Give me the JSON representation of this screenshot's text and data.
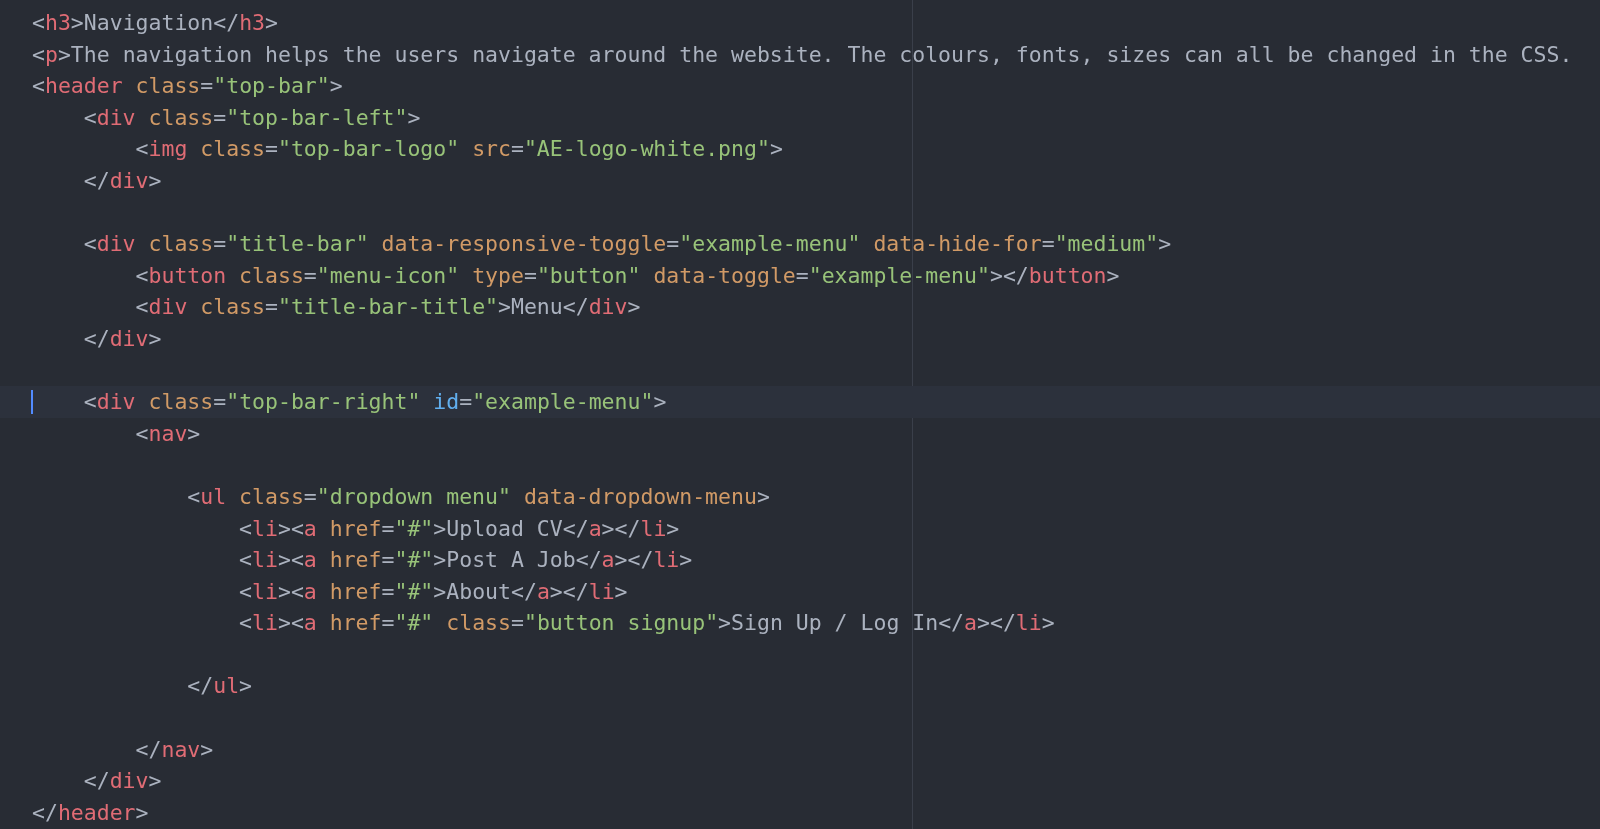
{
  "editor": {
    "lines": [
      {
        "active": false,
        "tokens": [
          {
            "kind": "punct",
            "text": "<"
          },
          {
            "kind": "tag",
            "text": "h3"
          },
          {
            "kind": "punct",
            "text": ">"
          },
          {
            "kind": "text",
            "text": "Navigation"
          },
          {
            "kind": "punct",
            "text": "</"
          },
          {
            "kind": "tag",
            "text": "h3"
          },
          {
            "kind": "punct",
            "text": ">"
          }
        ]
      },
      {
        "active": false,
        "tokens": [
          {
            "kind": "punct",
            "text": "<"
          },
          {
            "kind": "tag",
            "text": "p"
          },
          {
            "kind": "punct",
            "text": ">"
          },
          {
            "kind": "text",
            "text": "The navigation helps the users navigate around the website. The colours, fonts, sizes can all be changed in the CSS."
          }
        ]
      },
      {
        "active": false,
        "tokens": [
          {
            "kind": "punct",
            "text": "<"
          },
          {
            "kind": "tag",
            "text": "header"
          },
          {
            "kind": "attr",
            "text": " class"
          },
          {
            "kind": "punct",
            "text": "="
          },
          {
            "kind": "string",
            "text": "\"top-bar\""
          },
          {
            "kind": "punct",
            "text": ">"
          }
        ],
        "children": [
          {
            "active": false,
            "tokens": [
              {
                "kind": "punct",
                "text": "<"
              },
              {
                "kind": "tag",
                "text": "div"
              },
              {
                "kind": "attr",
                "text": " class"
              },
              {
                "kind": "punct",
                "text": "="
              },
              {
                "kind": "string",
                "text": "\"top-bar-left\""
              },
              {
                "kind": "punct",
                "text": ">"
              }
            ],
            "children": [
              {
                "active": false,
                "tokens": [
                  {
                    "kind": "punct",
                    "text": "<"
                  },
                  {
                    "kind": "tag",
                    "text": "img"
                  },
                  {
                    "kind": "attr",
                    "text": " class"
                  },
                  {
                    "kind": "punct",
                    "text": "="
                  },
                  {
                    "kind": "string",
                    "text": "\"top-bar-logo\""
                  },
                  {
                    "kind": "attr",
                    "text": " src"
                  },
                  {
                    "kind": "punct",
                    "text": "="
                  },
                  {
                    "kind": "string",
                    "text": "\"AE-logo-white.png\""
                  },
                  {
                    "kind": "punct",
                    "text": ">"
                  }
                ]
              }
            ]
          },
          {
            "active": false,
            "tokens": [
              {
                "kind": "punct",
                "text": "</"
              },
              {
                "kind": "tag",
                "text": "div"
              },
              {
                "kind": "punct",
                "text": ">"
              }
            ]
          },
          {
            "active": false
          },
          {
            "active": false,
            "tokens": [
              {
                "kind": "punct",
                "text": "<"
              },
              {
                "kind": "tag",
                "text": "div"
              },
              {
                "kind": "attr",
                "text": " class"
              },
              {
                "kind": "punct",
                "text": "="
              },
              {
                "kind": "string",
                "text": "\"title-bar\""
              },
              {
                "kind": "attr",
                "text": " data-responsive-toggle"
              },
              {
                "kind": "punct",
                "text": "="
              },
              {
                "kind": "string",
                "text": "\"example-menu\""
              },
              {
                "kind": "attr",
                "text": " data-hide-for"
              },
              {
                "kind": "punct",
                "text": "="
              },
              {
                "kind": "string",
                "text": "\"medium\""
              },
              {
                "kind": "punct",
                "text": ">"
              }
            ],
            "children": [
              {
                "active": false,
                "tokens": [
                  {
                    "kind": "punct",
                    "text": "<"
                  },
                  {
                    "kind": "tag",
                    "text": "button"
                  },
                  {
                    "kind": "attr",
                    "text": " class"
                  },
                  {
                    "kind": "punct",
                    "text": "="
                  },
                  {
                    "kind": "string",
                    "text": "\"menu-icon\""
                  },
                  {
                    "kind": "attr",
                    "text": " type"
                  },
                  {
                    "kind": "punct",
                    "text": "="
                  },
                  {
                    "kind": "string",
                    "text": "\"button\""
                  },
                  {
                    "kind": "attr",
                    "text": " data-toggle"
                  },
                  {
                    "kind": "punct",
                    "text": "="
                  },
                  {
                    "kind": "string",
                    "text": "\"example-menu\""
                  },
                  {
                    "kind": "punct",
                    "text": "></"
                  },
                  {
                    "kind": "tag",
                    "text": "button"
                  },
                  {
                    "kind": "punct",
                    "text": ">"
                  }
                ]
              },
              {
                "active": false,
                "tokens": [
                  {
                    "kind": "punct",
                    "text": "<"
                  },
                  {
                    "kind": "tag",
                    "text": "div"
                  },
                  {
                    "kind": "attr",
                    "text": " class"
                  },
                  {
                    "kind": "punct",
                    "text": "="
                  },
                  {
                    "kind": "string",
                    "text": "\"title-bar-title\""
                  },
                  {
                    "kind": "punct",
                    "text": ">"
                  },
                  {
                    "kind": "text",
                    "text": "Menu"
                  },
                  {
                    "kind": "punct",
                    "text": "</"
                  },
                  {
                    "kind": "tag",
                    "text": "div"
                  },
                  {
                    "kind": "punct",
                    "text": ">"
                  }
                ]
              }
            ]
          },
          {
            "active": false,
            "tokens": [
              {
                "kind": "punct",
                "text": "</"
              },
              {
                "kind": "tag",
                "text": "div"
              },
              {
                "kind": "punct",
                "text": ">"
              }
            ]
          },
          {
            "active": false
          },
          {
            "active": true,
            "tokens": [
              {
                "kind": "punct",
                "text": "<"
              },
              {
                "kind": "tag",
                "text": "div"
              },
              {
                "kind": "attr",
                "text": " class"
              },
              {
                "kind": "punct",
                "text": "="
              },
              {
                "kind": "string",
                "text": "\"top-bar-right\""
              },
              {
                "kind": "id",
                "text": " id"
              },
              {
                "kind": "punct",
                "text": "="
              },
              {
                "kind": "string",
                "text": "\"example-menu\""
              },
              {
                "kind": "punct",
                "text": ">"
              }
            ],
            "children": [
              {
                "active": false,
                "tokens": [
                  {
                    "kind": "punct",
                    "text": "<"
                  },
                  {
                    "kind": "tag",
                    "text": "nav"
                  },
                  {
                    "kind": "punct",
                    "text": ">"
                  }
                ],
                "children": [
                  {
                    "active": false
                  },
                  {
                    "active": false,
                    "tokens": [
                      {
                        "kind": "punct",
                        "text": "<"
                      },
                      {
                        "kind": "tag",
                        "text": "ul"
                      },
                      {
                        "kind": "attr",
                        "text": " class"
                      },
                      {
                        "kind": "punct",
                        "text": "="
                      },
                      {
                        "kind": "string",
                        "text": "\"dropdown menu\""
                      },
                      {
                        "kind": "attr",
                        "text": " data-dropdown-menu"
                      },
                      {
                        "kind": "punct",
                        "text": ">"
                      }
                    ],
                    "children": [
                      {
                        "active": false,
                        "tokens": [
                          {
                            "kind": "punct",
                            "text": "<"
                          },
                          {
                            "kind": "tag",
                            "text": "li"
                          },
                          {
                            "kind": "punct",
                            "text": "><"
                          },
                          {
                            "kind": "tag",
                            "text": "a"
                          },
                          {
                            "kind": "attr",
                            "text": " href"
                          },
                          {
                            "kind": "punct",
                            "text": "="
                          },
                          {
                            "kind": "string",
                            "text": "\"#\""
                          },
                          {
                            "kind": "punct",
                            "text": ">"
                          },
                          {
                            "kind": "text",
                            "text": "Upload CV"
                          },
                          {
                            "kind": "punct",
                            "text": "</"
                          },
                          {
                            "kind": "tag",
                            "text": "a"
                          },
                          {
                            "kind": "punct",
                            "text": "></"
                          },
                          {
                            "kind": "tag",
                            "text": "li"
                          },
                          {
                            "kind": "punct",
                            "text": ">"
                          }
                        ]
                      },
                      {
                        "active": false,
                        "tokens": [
                          {
                            "kind": "punct",
                            "text": "<"
                          },
                          {
                            "kind": "tag",
                            "text": "li"
                          },
                          {
                            "kind": "punct",
                            "text": "><"
                          },
                          {
                            "kind": "tag",
                            "text": "a"
                          },
                          {
                            "kind": "attr",
                            "text": " href"
                          },
                          {
                            "kind": "punct",
                            "text": "="
                          },
                          {
                            "kind": "string",
                            "text": "\"#\""
                          },
                          {
                            "kind": "punct",
                            "text": ">"
                          },
                          {
                            "kind": "text",
                            "text": "Post A Job"
                          },
                          {
                            "kind": "punct",
                            "text": "</"
                          },
                          {
                            "kind": "tag",
                            "text": "a"
                          },
                          {
                            "kind": "punct",
                            "text": "></"
                          },
                          {
                            "kind": "tag",
                            "text": "li"
                          },
                          {
                            "kind": "punct",
                            "text": ">"
                          }
                        ]
                      },
                      {
                        "active": false,
                        "tokens": [
                          {
                            "kind": "punct",
                            "text": "<"
                          },
                          {
                            "kind": "tag",
                            "text": "li"
                          },
                          {
                            "kind": "punct",
                            "text": "><"
                          },
                          {
                            "kind": "tag",
                            "text": "a"
                          },
                          {
                            "kind": "attr",
                            "text": " href"
                          },
                          {
                            "kind": "punct",
                            "text": "="
                          },
                          {
                            "kind": "string",
                            "text": "\"#\""
                          },
                          {
                            "kind": "punct",
                            "text": ">"
                          },
                          {
                            "kind": "text",
                            "text": "About"
                          },
                          {
                            "kind": "punct",
                            "text": "</"
                          },
                          {
                            "kind": "tag",
                            "text": "a"
                          },
                          {
                            "kind": "punct",
                            "text": "></"
                          },
                          {
                            "kind": "tag",
                            "text": "li"
                          },
                          {
                            "kind": "punct",
                            "text": ">"
                          }
                        ]
                      },
                      {
                        "active": false,
                        "tokens": [
                          {
                            "kind": "punct",
                            "text": "<"
                          },
                          {
                            "kind": "tag",
                            "text": "li"
                          },
                          {
                            "kind": "punct",
                            "text": "><"
                          },
                          {
                            "kind": "tag",
                            "text": "a"
                          },
                          {
                            "kind": "attr",
                            "text": " href"
                          },
                          {
                            "kind": "punct",
                            "text": "="
                          },
                          {
                            "kind": "string",
                            "text": "\"#\""
                          },
                          {
                            "kind": "attr",
                            "text": " class"
                          },
                          {
                            "kind": "punct",
                            "text": "="
                          },
                          {
                            "kind": "string",
                            "text": "\"button signup\""
                          },
                          {
                            "kind": "punct",
                            "text": ">"
                          },
                          {
                            "kind": "text",
                            "text": "Sign Up / Log In"
                          },
                          {
                            "kind": "punct",
                            "text": "</"
                          },
                          {
                            "kind": "tag",
                            "text": "a"
                          },
                          {
                            "kind": "punct",
                            "text": "></"
                          },
                          {
                            "kind": "tag",
                            "text": "li"
                          },
                          {
                            "kind": "punct",
                            "text": ">"
                          }
                        ]
                      },
                      {
                        "active": false
                      }
                    ]
                  },
                  {
                    "active": false,
                    "tokens": [
                      {
                        "kind": "punct",
                        "text": "</"
                      },
                      {
                        "kind": "tag",
                        "text": "ul"
                      },
                      {
                        "kind": "punct",
                        "text": ">"
                      }
                    ]
                  },
                  {
                    "active": false
                  }
                ]
              },
              {
                "active": false,
                "tokens": [
                  {
                    "kind": "punct",
                    "text": "</"
                  },
                  {
                    "kind": "tag",
                    "text": "nav"
                  },
                  {
                    "kind": "punct",
                    "text": ">"
                  }
                ]
              }
            ]
          },
          {
            "active": false,
            "tokens": [
              {
                "kind": "punct",
                "text": "</"
              },
              {
                "kind": "tag",
                "text": "div"
              },
              {
                "kind": "punct",
                "text": ">"
              }
            ]
          }
        ]
      },
      {
        "active": false,
        "tokens": [
          {
            "kind": "punct",
            "text": "</"
          },
          {
            "kind": "tag",
            "text": "header"
          },
          {
            "kind": "punct",
            "text": ">"
          }
        ]
      }
    ]
  }
}
